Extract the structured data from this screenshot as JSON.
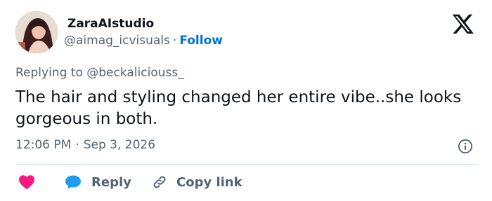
{
  "author": {
    "display_name": "ZaraAIstudio",
    "handle": "@aimag_icvisuals",
    "separator": "·",
    "follow_label": "Follow"
  },
  "reply_context": {
    "prefix": "Replying to ",
    "mention": "@beckaliciouss_"
  },
  "tweet": {
    "text": "The hair and styling changed her entire vibe..she looks gorgeous in both."
  },
  "meta": {
    "time": "12:06 PM",
    "separator": "·",
    "date": "Sep 3, 2026"
  },
  "actions": {
    "reply_label": "Reply",
    "copy_link_label": "Copy link"
  },
  "icons": {
    "logo": "x-logo-icon",
    "info": "info-icon",
    "like": "heart-icon",
    "reply": "speech-bubble-icon",
    "copy": "link-icon"
  },
  "colors": {
    "text_primary": "#0f1419",
    "text_secondary": "#536471",
    "follow_blue": "#006fd6",
    "heart_pink": "#f91880",
    "reply_blue": "#1d9bf0",
    "divider": "#cfd9de"
  }
}
